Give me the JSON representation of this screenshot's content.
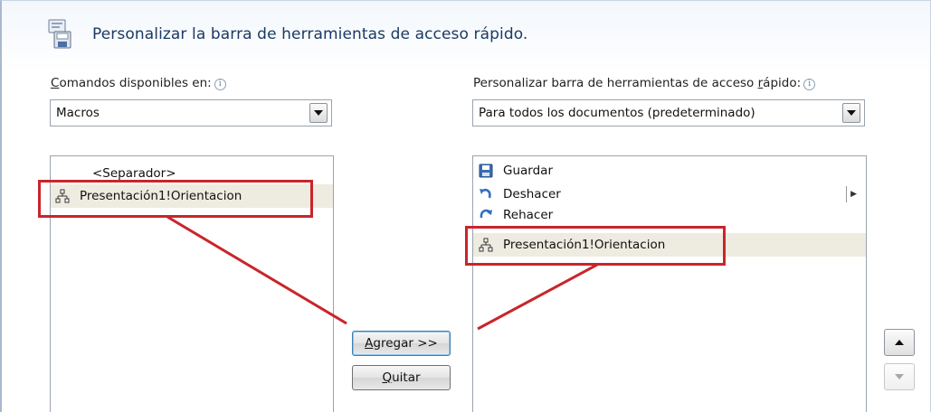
{
  "dialog": {
    "title": "Personalizar la barra de herramientas de acceso rápido."
  },
  "left_panel": {
    "label_prefix": "C",
    "label_rest": "omandos disponibles en:",
    "info": "i",
    "combo_value": "Macros",
    "items": [
      {
        "label": "<Separador>",
        "icon": "none"
      },
      {
        "label": "Presentación1!Orientacion",
        "icon": "macro-icon"
      }
    ]
  },
  "right_panel": {
    "label_a": "Personalizar barra de herramientas de acceso ",
    "label_accel": "r",
    "label_b": "ápido:",
    "info": "i",
    "combo_value": "Para todos los documentos (predeterminado)",
    "items": [
      {
        "label": "Guardar",
        "icon": "save-icon"
      },
      {
        "label": "Deshacer",
        "icon": "undo-icon"
      },
      {
        "label": "Rehacer",
        "icon": "redo-icon"
      },
      {
        "label": "Presentación1!Orientacion",
        "icon": "macro-icon"
      }
    ]
  },
  "buttons": {
    "add_accel": "A",
    "add_rest": "gregar >>",
    "remove_accel": "Q",
    "remove_rest": "uitar"
  },
  "colors": {
    "highlight": "#c9252b",
    "selection": "#eeebe0",
    "title": "#1b3a63"
  }
}
